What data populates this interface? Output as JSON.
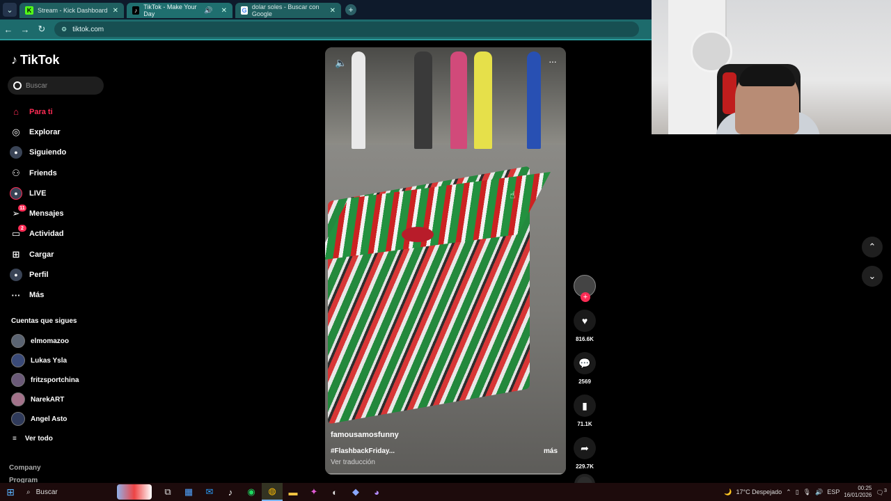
{
  "browser": {
    "tabs": [
      {
        "label": "Stream - Kick Dashboard",
        "favicon": "K"
      },
      {
        "label": "TikTok - Make Your Day",
        "favicon": "♪"
      },
      {
        "label": "dolar soles - Buscar con Google",
        "favicon": "G"
      }
    ],
    "url": "tiktok.com"
  },
  "sidebar": {
    "brand": "TikTok",
    "search_placeholder": "Buscar",
    "items": [
      {
        "label": "Para ti",
        "icon": "home-icon"
      },
      {
        "label": "Explorar",
        "icon": "compass-icon"
      },
      {
        "label": "Siguiendo",
        "icon": "following-avatar-icon"
      },
      {
        "label": "Friends",
        "icon": "friends-icon"
      },
      {
        "label": "LIVE",
        "icon": "live-icon"
      },
      {
        "label": "Mensajes",
        "icon": "messages-icon",
        "badge": "11"
      },
      {
        "label": "Actividad",
        "icon": "activity-icon",
        "badge": "2"
      },
      {
        "label": "Cargar",
        "icon": "upload-icon"
      },
      {
        "label": "Perfil",
        "icon": "profile-icon"
      },
      {
        "label": "Más",
        "icon": "more-icon"
      }
    ],
    "following_title": "Cuentas que sigues",
    "following": [
      "elmomazoo",
      "Lukas Ysla",
      "fritzsportchina",
      "NarekART",
      "Angel Asto"
    ],
    "see_all": "Ver todo",
    "footer": [
      "Company",
      "Program"
    ]
  },
  "video": {
    "username": "famousamosfunny",
    "caption": "#FlashbackFriday...",
    "more": "más",
    "translate": "Ver traducción"
  },
  "actions": {
    "likes": "816.6K",
    "comments": "2569",
    "saves": "71.1K",
    "shares": "229.7K"
  },
  "taskbar": {
    "search": "Buscar",
    "weather": "17°C  Despejado",
    "lang": "ESP",
    "time": "00:25",
    "date": "16/01/2026",
    "notif": "3"
  }
}
